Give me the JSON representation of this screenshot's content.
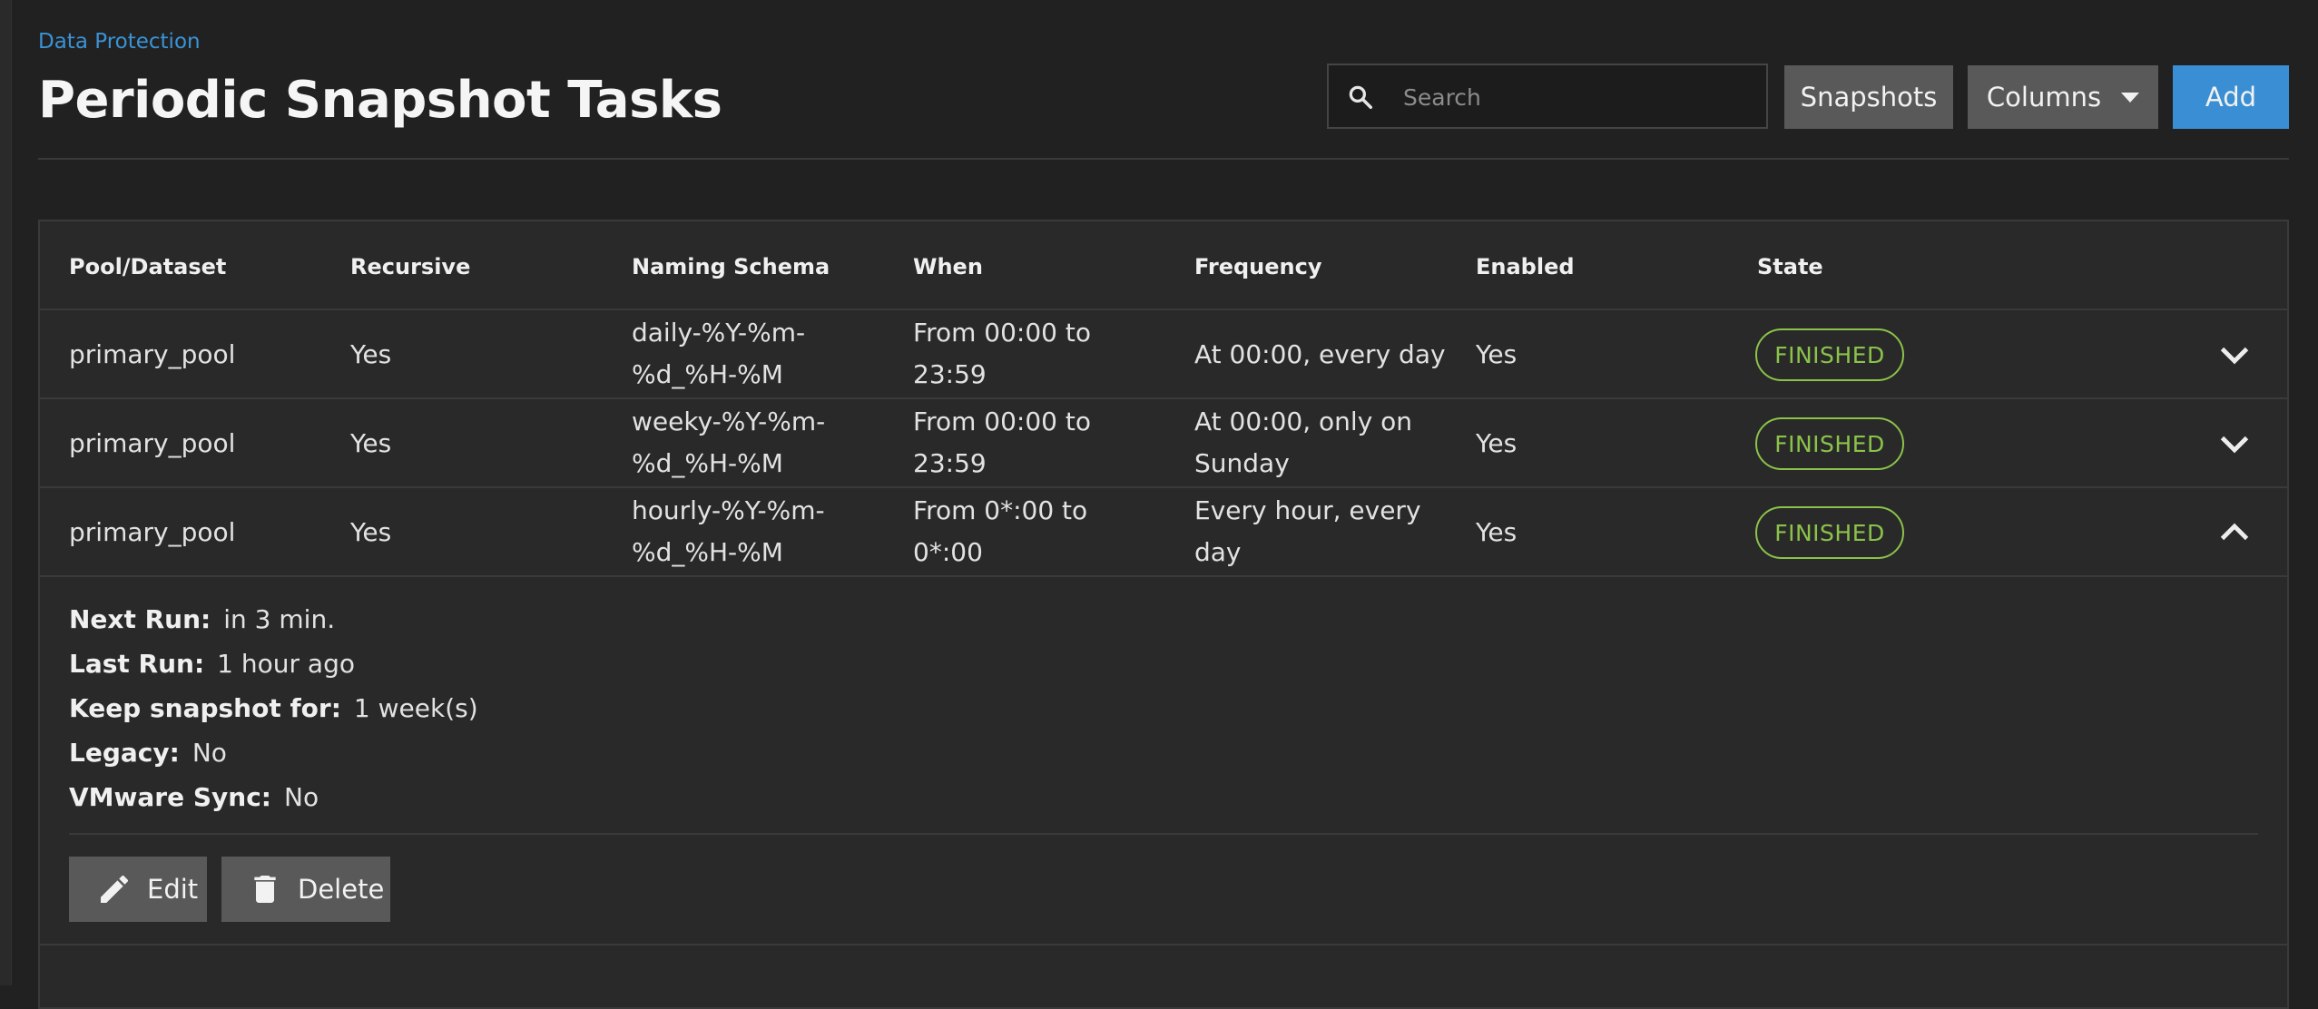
{
  "header": {
    "breadcrumb": "Data Protection",
    "title": "Periodic Snapshot Tasks"
  },
  "toolbar": {
    "search_placeholder": "Search",
    "snapshots_label": "Snapshots",
    "columns_label": "Columns",
    "add_label": "Add"
  },
  "table": {
    "columns": [
      "Pool/Dataset",
      "Recursive",
      "Naming Schema",
      "When",
      "Frequency",
      "Enabled",
      "State"
    ],
    "rows": [
      {
        "dataset": "primary_pool",
        "recursive": "Yes",
        "schema_1": "daily-%Y-%m-",
        "schema_2": "%d_%H-%M",
        "when_1": "From 00:00 to",
        "when_2": "23:59",
        "freq_1": "At 00:00, every day",
        "freq_2": "",
        "enabled": "Yes",
        "state": "FINISHED",
        "expanded": false
      },
      {
        "dataset": "primary_pool",
        "recursive": "Yes",
        "schema_1": "weeky-%Y-%m-",
        "schema_2": "%d_%H-%M",
        "when_1": "From 00:00 to",
        "when_2": "23:59",
        "freq_1": "At 00:00, only on",
        "freq_2": "Sunday",
        "enabled": "Yes",
        "state": "FINISHED",
        "expanded": false
      },
      {
        "dataset": "primary_pool",
        "recursive": "Yes",
        "schema_1": "hourly-%Y-%m-",
        "schema_2": "%d_%H-%M",
        "when_1": "From 0*:00 to",
        "when_2": "0*:00",
        "freq_1": "Every hour, every",
        "freq_2": "day",
        "enabled": "Yes",
        "state": "FINISHED",
        "expanded": true
      }
    ]
  },
  "details": {
    "next_run_label": "Next Run:",
    "next_run": "in 3 min.",
    "last_run_label": "Last Run:",
    "last_run": "1 hour ago",
    "keep_label": "Keep snapshot for:",
    "keep": "1 week(s)",
    "legacy_label": "Legacy:",
    "legacy": "No",
    "vmware_label": "VMware Sync:",
    "vmware": "No",
    "edit_label": "Edit",
    "delete_label": "Delete"
  },
  "colors": {
    "accent": "#3a8fd4",
    "status_finished": "#8bc34a",
    "background": "#212121",
    "panel": "#292929"
  },
  "icons": [
    "search-icon",
    "caret-down-icon",
    "chevron-down-icon",
    "chevron-up-icon",
    "pencil-icon",
    "trash-icon"
  ]
}
